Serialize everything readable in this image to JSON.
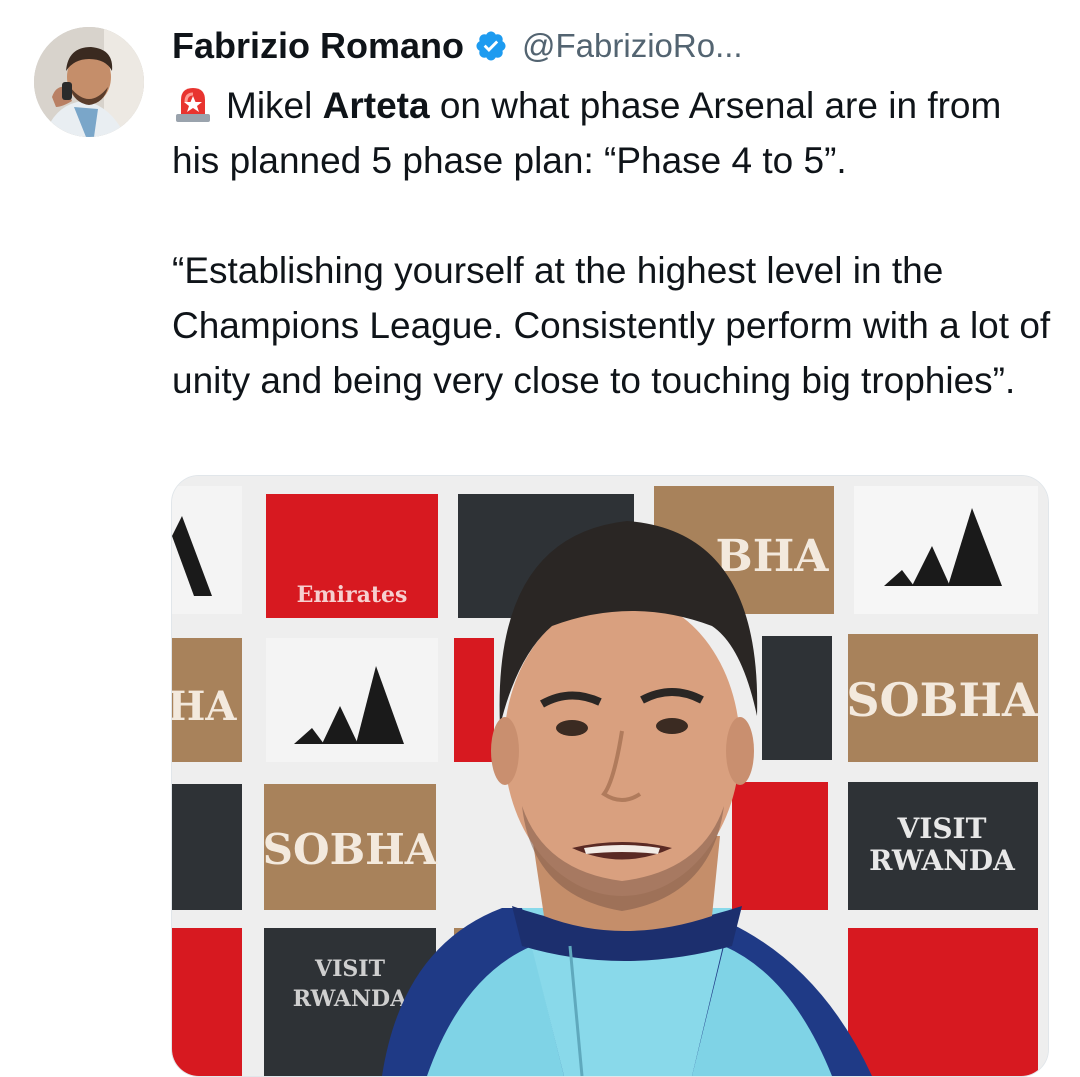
{
  "author": {
    "name": "Fabrizio Romano",
    "handle": "@FabrizioRo...",
    "verified": true,
    "avatar_icon": "profile-photo"
  },
  "tweet": {
    "emoji_icon": "rotating-light-siren-icon",
    "line1_pre": "Mikel ",
    "line1_bold": "Arteta",
    "line1_post": " on what phase Arsenal are in from his planned 5 phase plan: “Phase 4 to 5”.",
    "quote": "“Establishing yourself at the highest level in the Champions League. Consistently perform with a lot of unity and being very close to touching big trophies”."
  },
  "media": {
    "sponsors": {
      "sobha": "SOBHA",
      "emirates": "Emirates",
      "visit": "VISIT",
      "rwanda": "RWANDA",
      "sobha_partial_1": "BHA",
      "sobha_partial_2": "HA",
      "sobha_partial_3": "SO"
    }
  },
  "colors": {
    "text": "#0f1419",
    "secondary": "#536471",
    "verified": "#1d9bf0",
    "emirates_red": "#d71920",
    "sobha_gold": "#a8825b",
    "rwanda_dark": "#2e3236"
  }
}
